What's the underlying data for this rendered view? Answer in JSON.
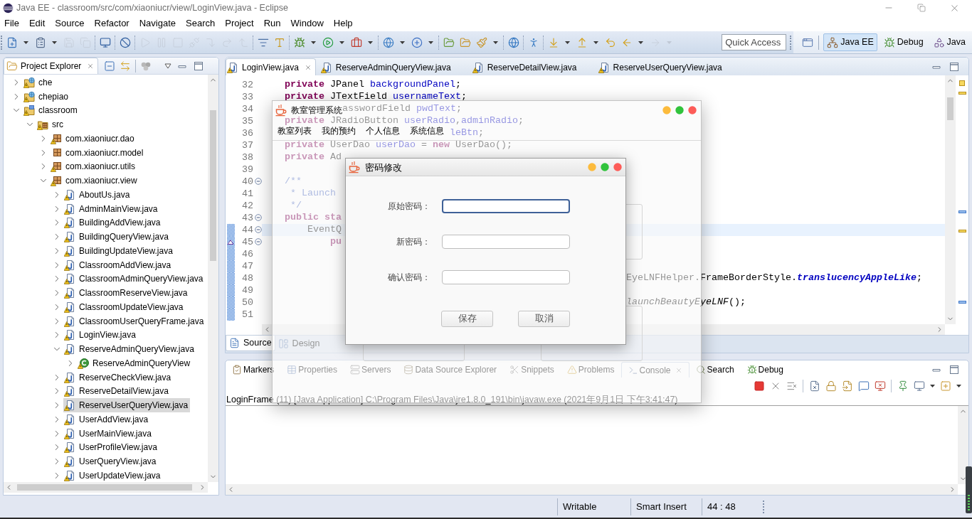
{
  "window": {
    "title": "Java EE - classroom/src/com/xiaoniucr/view/LoginView.java - Eclipse"
  },
  "menu": [
    "File",
    "Edit",
    "Source",
    "Refactor",
    "Navigate",
    "Search",
    "Project",
    "Run",
    "Window",
    "Help"
  ],
  "toolbar": {
    "buttons": [
      {
        "disabled": false
      },
      {
        "disabled": false
      },
      {
        "disabled": true
      },
      {
        "disabled": true
      },
      {
        "disabled": false
      },
      {
        "disabled": false
      },
      {
        "disabled": true
      },
      {
        "disabled": true
      },
      {
        "disabled": true
      },
      {
        "disabled": true
      },
      {
        "disabled": true
      },
      {
        "disabled": true
      },
      {
        "disabled": true
      },
      {
        "disabled": false
      },
      {
        "disabled": false
      },
      {
        "disabled": false
      },
      {
        "disabled": false
      },
      {
        "disabled": false
      },
      {
        "disabled": false
      },
      {
        "disabled": false
      },
      {
        "disabled": false
      },
      {
        "disabled": false
      },
      {
        "disabled": false
      },
      {
        "disabled": false
      },
      {
        "disabled": false
      },
      {
        "disabled": false
      },
      {
        "disabled": false
      },
      {
        "disabled": false
      },
      {
        "disabled": false
      },
      {
        "disabled": true
      }
    ],
    "quick_access": {
      "placeholder": "Quick Access"
    },
    "perspectives": [
      {
        "label": "Java EE",
        "kind": "javaee",
        "selected": true
      },
      {
        "label": "Debug",
        "kind": "debug",
        "selected": false
      },
      {
        "label": "Java",
        "kind": "java",
        "selected": false
      }
    ]
  },
  "project_explorer": {
    "tab": {
      "label": "Project Explorer"
    },
    "tree": [
      {
        "label": "che",
        "kind": "web-project",
        "warning": true,
        "expanded": false,
        "selected": false
      },
      {
        "label": "chepiao",
        "kind": "web-project",
        "warning": true,
        "expanded": false,
        "selected": false
      },
      {
        "label": "classroom",
        "kind": "project",
        "warning": true,
        "expanded": true,
        "selected": false,
        "children": [
          {
            "label": "src",
            "kind": "source-folder",
            "warning": true,
            "expanded": true,
            "selected": false,
            "children": [
              {
                "label": "com.xiaoniucr.dao",
                "kind": "package",
                "warning": true,
                "expanded": false,
                "selected": false
              },
              {
                "label": "com.xiaoniucr.model",
                "kind": "package",
                "warning": false,
                "expanded": false,
                "selected": false
              },
              {
                "label": "com.xiaoniucr.utils",
                "kind": "package",
                "warning": true,
                "expanded": false,
                "selected": false
              },
              {
                "label": "com.xiaoniucr.view",
                "kind": "package",
                "warning": true,
                "expanded": true,
                "selected": false,
                "children": [
                  {
                    "label": "AboutUs.java",
                    "kind": "java-file",
                    "warning": true,
                    "expanded": false,
                    "selected": false
                  },
                  {
                    "label": "AdminMainView.java",
                    "kind": "java-file",
                    "warning": true,
                    "expanded": false,
                    "selected": false
                  },
                  {
                    "label": "BuildingAddView.java",
                    "kind": "java-file",
                    "warning": true,
                    "expanded": false,
                    "selected": false
                  },
                  {
                    "label": "BuildingQueryView.java",
                    "kind": "java-file",
                    "warning": true,
                    "expanded": false,
                    "selected": false
                  },
                  {
                    "label": "BuildingUpdateView.java",
                    "kind": "java-file",
                    "warning": true,
                    "expanded": false,
                    "selected": false
                  },
                  {
                    "label": "ClassroomAddView.java",
                    "kind": "java-file",
                    "warning": true,
                    "expanded": false,
                    "selected": false
                  },
                  {
                    "label": "ClassroomAdminQueryView.java",
                    "kind": "java-file",
                    "warning": true,
                    "expanded": false,
                    "selected": false
                  },
                  {
                    "label": "ClassroomReserveView.java",
                    "kind": "java-file",
                    "warning": true,
                    "expanded": false,
                    "selected": false
                  },
                  {
                    "label": "ClassroomUpdateView.java",
                    "kind": "java-file",
                    "warning": true,
                    "expanded": false,
                    "selected": false
                  },
                  {
                    "label": "ClassroomUserQueryFrame.java",
                    "kind": "java-file",
                    "warning": true,
                    "expanded": false,
                    "selected": false
                  },
                  {
                    "label": "LoginView.java",
                    "kind": "java-file",
                    "warning": true,
                    "expanded": false,
                    "selected": false
                  },
                  {
                    "label": "ReserveAdminQueryView.java",
                    "kind": "java-file",
                    "warning": true,
                    "expanded": true,
                    "selected": false,
                    "children": [
                      {
                        "label": "ReserveAdminQueryView",
                        "kind": "class",
                        "warning": true,
                        "expanded": false,
                        "selected": false
                      }
                    ]
                  },
                  {
                    "label": "ReserveCheckView.java",
                    "kind": "java-file",
                    "warning": true,
                    "expanded": false,
                    "selected": false
                  },
                  {
                    "label": "ReserveDetailView.java",
                    "kind": "java-file",
                    "warning": true,
                    "expanded": false,
                    "selected": false
                  },
                  {
                    "label": "ReserveUserQueryView.java",
                    "kind": "java-file",
                    "warning": true,
                    "expanded": false,
                    "selected": true
                  },
                  {
                    "label": "UserAddView.java",
                    "kind": "java-file",
                    "warning": true,
                    "expanded": false,
                    "selected": false
                  },
                  {
                    "label": "UserMainView.java",
                    "kind": "java-file",
                    "warning": true,
                    "expanded": false,
                    "selected": false
                  },
                  {
                    "label": "UserProfileView.java",
                    "kind": "java-file",
                    "warning": true,
                    "expanded": false,
                    "selected": false
                  },
                  {
                    "label": "UserQueryView.java",
                    "kind": "java-file",
                    "warning": true,
                    "expanded": false,
                    "selected": false
                  },
                  {
                    "label": "UserUpdateView.java",
                    "kind": "java-file",
                    "warning": true,
                    "expanded": false,
                    "selected": false
                  }
                ]
              }
            ]
          }
        ]
      }
    ]
  },
  "editor": {
    "tabs": [
      {
        "label": "LoginView.java",
        "selected": true,
        "warning": true
      },
      {
        "label": "ReserveAdminQueryView.java",
        "selected": false,
        "warning": true
      },
      {
        "label": "ReserveDetailView.java",
        "selected": false,
        "warning": true
      },
      {
        "label": "ReserveUserQueryView.java",
        "selected": false,
        "warning": true
      }
    ],
    "lines": [
      {
        "number": "32",
        "kind": "indent1",
        "current": false,
        "fold_toggle": false,
        "changed": false,
        "annotated": false,
        "tokens": [
          {
            "text": "private",
            "kind": "keyword"
          },
          {
            "text": " JPanel ",
            "kind": "plain"
          },
          {
            "text": "backgroundPanel",
            "kind": "field"
          },
          {
            "text": ";",
            "kind": "plain"
          }
        ]
      },
      {
        "number": "33",
        "kind": "indent1",
        "current": false,
        "fold_toggle": false,
        "changed": false,
        "annotated": false,
        "tokens": [
          {
            "text": "private",
            "kind": "keyword"
          },
          {
            "text": " JTextField ",
            "kind": "plain"
          },
          {
            "text": "usernameText",
            "kind": "field"
          },
          {
            "text": ";",
            "kind": "plain"
          }
        ]
      },
      {
        "number": "34",
        "kind": "aftertitle",
        "current": false,
        "fold_toggle": false,
        "changed": false,
        "annotated": false,
        "tokens": [
          {
            "text": "asswordField ",
            "kind": "plain"
          },
          {
            "text": "pwdText",
            "kind": "field"
          },
          {
            "text": ";",
            "kind": "plain"
          }
        ]
      },
      {
        "number": "35",
        "kind": "indent1",
        "current": false,
        "fold_toggle": false,
        "changed": false,
        "annotated": false,
        "tokens": [
          {
            "text": "private",
            "kind": "keyword"
          },
          {
            "text": " JRadioButton ",
            "kind": "plain"
          },
          {
            "text": "userRadio",
            "kind": "field"
          },
          {
            "text": ",",
            "kind": "plain"
          },
          {
            "text": "adminRadio",
            "kind": "field"
          },
          {
            "text": ";",
            "kind": "plain"
          }
        ]
      },
      {
        "number": "36",
        "kind": "aftermenu",
        "current": false,
        "fold_toggle": false,
        "changed": false,
        "annotated": false,
        "tokens": [
          {
            "text": "leBtn",
            "kind": "field"
          },
          {
            "text": ";",
            "kind": "plain"
          }
        ]
      },
      {
        "number": "37",
        "kind": "indent1",
        "current": false,
        "fold_toggle": false,
        "changed": false,
        "annotated": false,
        "tokens": [
          {
            "text": "private",
            "kind": "keyword"
          },
          {
            "text": " UserDao ",
            "kind": "plain"
          },
          {
            "text": "userDao",
            "kind": "field"
          },
          {
            "text": " = ",
            "kind": "plain"
          },
          {
            "text": "new",
            "kind": "keyword"
          },
          {
            "text": " UserDao();",
            "kind": "plain"
          }
        ]
      },
      {
        "number": "38",
        "kind": "indent1",
        "current": false,
        "fold_toggle": false,
        "changed": false,
        "annotated": false,
        "tokens": [
          {
            "text": "private",
            "kind": "keyword"
          },
          {
            "text": " Ad",
            "kind": "plain"
          }
        ]
      },
      {
        "number": "39",
        "current": false,
        "fold_toggle": false,
        "changed": false,
        "annotated": false
      },
      {
        "number": "40",
        "kind": "indent1",
        "current": false,
        "fold_toggle": true,
        "changed": false,
        "annotated": false,
        "tokens": [
          {
            "text": "/**",
            "kind": "comment"
          }
        ]
      },
      {
        "number": "41",
        "kind": "indent1b",
        "current": false,
        "fold_toggle": false,
        "changed": false,
        "annotated": false,
        "tokens": [
          {
            "text": "* Launch",
            "kind": "comment"
          }
        ]
      },
      {
        "number": "42",
        "kind": "indent1b",
        "current": false,
        "fold_toggle": false,
        "changed": false,
        "annotated": false,
        "tokens": [
          {
            "text": "*/",
            "kind": "comment"
          }
        ]
      },
      {
        "number": "43",
        "kind": "indent1",
        "current": false,
        "fold_toggle": true,
        "changed": false,
        "annotated": false,
        "tokens": [
          {
            "text": "public sta",
            "kind": "keyword"
          }
        ]
      },
      {
        "number": "44",
        "kind": "indent2",
        "current": true,
        "fold_toggle": true,
        "changed": true,
        "annotated": false,
        "tokens": [
          {
            "text": "EventQ",
            "kind": "plain"
          }
        ]
      },
      {
        "number": "45",
        "kind": "indent3",
        "current": false,
        "fold_toggle": true,
        "changed": true,
        "annotated": true,
        "tokens": [
          {
            "text": "pu",
            "kind": "keyword"
          }
        ]
      },
      {
        "number": "46",
        "current": false,
        "fold_toggle": false,
        "changed": true,
        "annotated": false
      },
      {
        "number": "47",
        "current": false,
        "fold_toggle": false,
        "changed": true,
        "annotated": false
      },
      {
        "number": "48",
        "kind": "afterdialog",
        "current": false,
        "fold_toggle": false,
        "changed": true,
        "annotated": false,
        "tokens": [
          {
            "text": "EyeLNFHelper.FrameBorderStyle.",
            "kind": "plain"
          },
          {
            "text": "translucencyAppleLike",
            "kind": "static-field"
          },
          {
            "text": ";",
            "kind": "plain"
          }
        ]
      },
      {
        "number": "49",
        "current": false,
        "fold_toggle": false,
        "changed": true,
        "annotated": false
      },
      {
        "number": "50",
        "kind": "afterdialog",
        "current": false,
        "fold_toggle": false,
        "changed": true,
        "annotated": false,
        "tokens": [
          {
            "text": "launchBeautyEyeLNF",
            "kind": "static-method"
          },
          {
            "text": "();",
            "kind": "plain"
          }
        ]
      },
      {
        "number": "51",
        "current": false,
        "fold_toggle": false,
        "changed": true,
        "annotated": false
      }
    ],
    "bottom_tabs": [
      {
        "label": "Source",
        "kind": "source",
        "selected": true
      },
      {
        "label": "Design",
        "kind": "design",
        "selected": false
      }
    ]
  },
  "console_panel": {
    "tabs": [
      {
        "label": "Markers",
        "kind": "markers",
        "selected": false
      },
      {
        "label": "Properties",
        "kind": "properties",
        "selected": false
      },
      {
        "label": "Servers",
        "kind": "servers",
        "selected": false
      },
      {
        "label": "Data Source Explorer",
        "kind": "data-source",
        "selected": false
      },
      {
        "label": "Snippets",
        "kind": "snippets",
        "selected": false
      },
      {
        "label": "Problems",
        "kind": "problems",
        "selected": false
      },
      {
        "label": "Console",
        "kind": "console",
        "selected": true
      },
      {
        "label": "Search",
        "kind": "search",
        "selected": false
      },
      {
        "label": "Debug",
        "kind": "debug",
        "selected": false
      }
    ],
    "launch_label": "LoginFrame (11) [Java Application] C:\\Program Files\\Java\\jre1.8.0_191\\bin\\javaw.exe (2021年9月1日 下午3:41:47)"
  },
  "status_bar": [
    "Writable",
    "Smart Insert",
    "44 : 48"
  ],
  "app_window": {
    "title": "教室管理系统",
    "menu": [
      "教室列表",
      "我的预约",
      "个人信息",
      "系统信息"
    ]
  },
  "dialog": {
    "title": "密码修改",
    "fields": [
      {
        "label": "原始密码：",
        "focused": true
      },
      {
        "label": "新密码：",
        "focused": false
      },
      {
        "label": "确认密码：",
        "focused": false
      }
    ],
    "buttons": [
      "保存",
      "取消"
    ]
  }
}
